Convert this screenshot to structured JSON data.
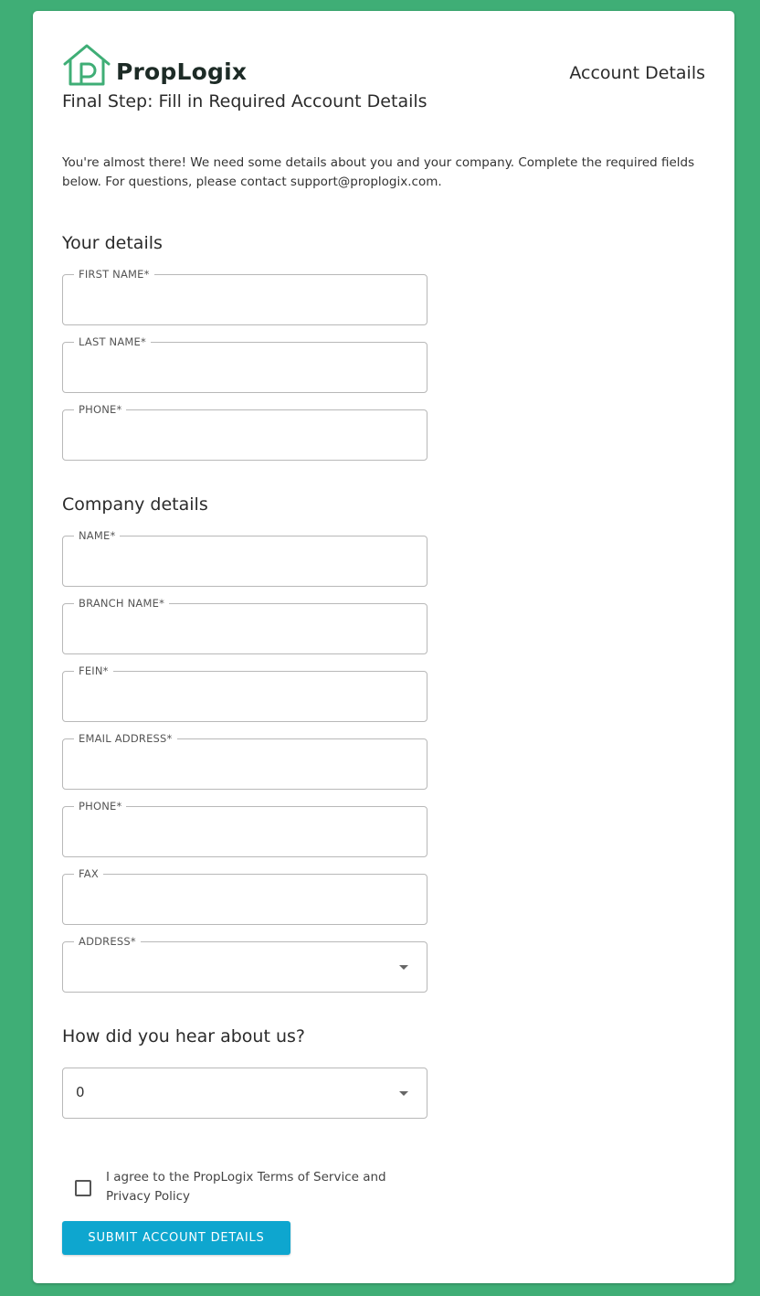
{
  "brand": {
    "name": "PropLogix",
    "color": "#3fae76",
    "logo_icon": "house-p-logo-icon"
  },
  "header": {
    "page_title": "Account Details",
    "subtitle": "Final Step: Fill in Required Account Details"
  },
  "intro": "You're almost there! We need some details about you and your company. Complete the required fields below. For questions, please contact support@proplogix.com.",
  "your_details": {
    "title": "Your details",
    "fields": {
      "first_name": {
        "label": "FIRST NAME*",
        "value": ""
      },
      "last_name": {
        "label": "LAST NAME*",
        "value": ""
      },
      "phone": {
        "label": "PHONE*",
        "value": ""
      }
    }
  },
  "company_details": {
    "title": "Company details",
    "fields": {
      "name": {
        "label": "NAME*",
        "value": ""
      },
      "branch_name": {
        "label": "BRANCH NAME*",
        "value": ""
      },
      "fein": {
        "label": "FEIN*",
        "value": ""
      },
      "email": {
        "label": "EMAIL ADDRESS*",
        "value": ""
      },
      "phone": {
        "label": "PHONE*",
        "value": ""
      },
      "fax": {
        "label": "FAX",
        "value": ""
      },
      "address": {
        "label": "ADDRESS*",
        "value": ""
      }
    }
  },
  "referral": {
    "title": "How did you hear about us?",
    "selected": "0"
  },
  "terms": {
    "checked": false,
    "label": "I agree to the PropLogix Terms of Service and Privacy Policy"
  },
  "submit_label": "SUBMIT ACCOUNT DETAILS",
  "colors": {
    "background": "#3fae76",
    "button": "#0ea6cf",
    "logo": "#3fae76"
  }
}
